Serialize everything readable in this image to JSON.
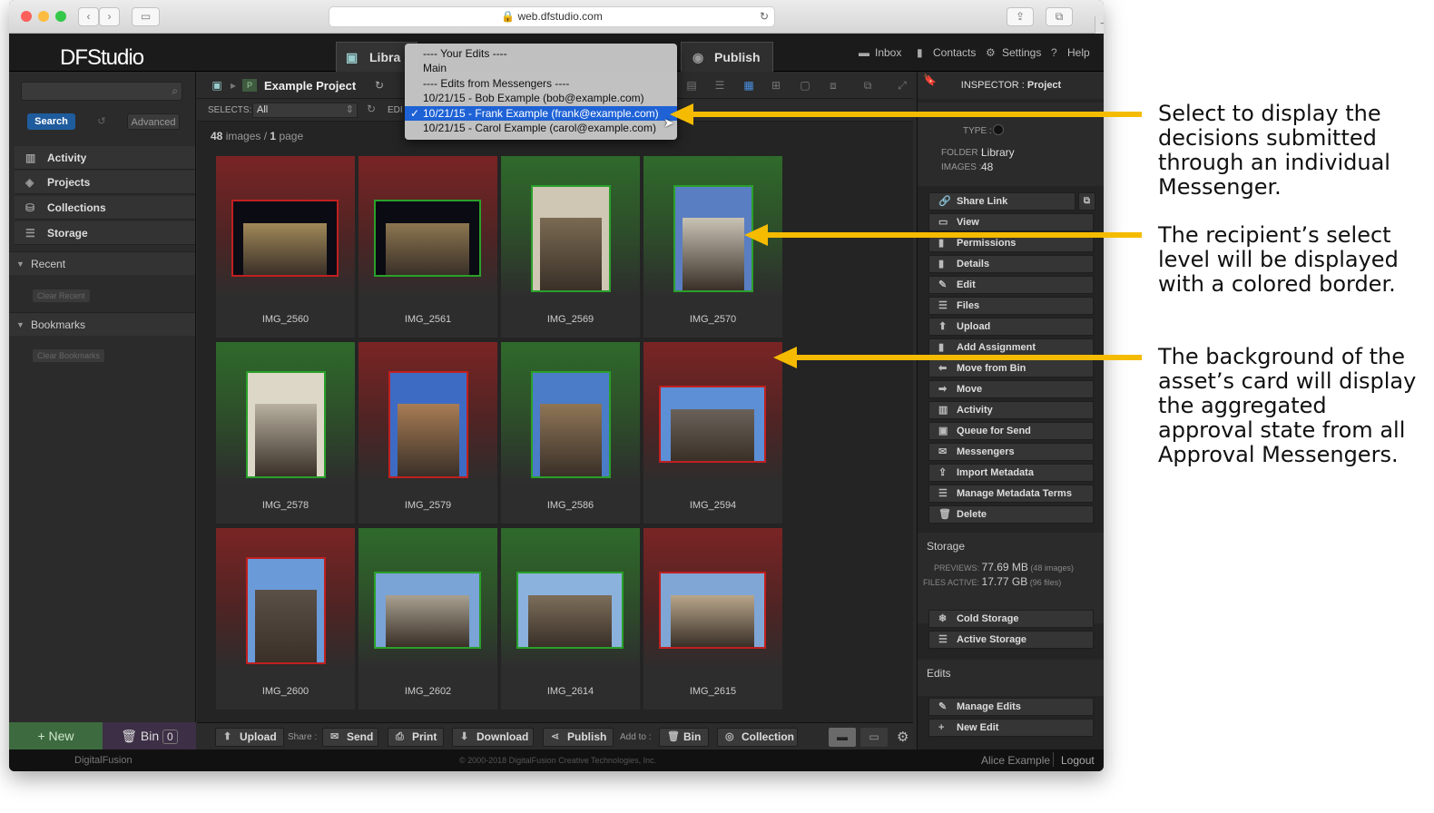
{
  "browser": {
    "url": "web.dfstudio.com",
    "new_tab": "+"
  },
  "app": {
    "logo": "DFStudio",
    "tabs": {
      "library": "Libra",
      "publish": "Publish"
    },
    "top_links": {
      "inbox": "Inbox",
      "contacts": "Contacts",
      "settings": "Settings",
      "help": "Help"
    }
  },
  "sidebar": {
    "search_button": "Search",
    "advanced_button": "Advanced",
    "items": [
      {
        "label": "Activity",
        "icon": "bar-chart-icon"
      },
      {
        "label": "Projects",
        "icon": "layers-icon"
      },
      {
        "label": "Collections",
        "icon": "database-icon"
      },
      {
        "label": "Storage",
        "icon": "storage-icon"
      }
    ],
    "recent": {
      "label": "Recent",
      "clear": "Clear Recent"
    },
    "bookmarks": {
      "label": "Bookmarks",
      "clear": "Clear Bookmarks"
    },
    "new_button": "+ New",
    "bin_label": "Bin",
    "bin_count": "0"
  },
  "main": {
    "project_title": "Example Project",
    "selects_label": "SELECTS:",
    "selects_value": "All",
    "edit_label": "EDI",
    "image_count": "48",
    "images_word": "images /",
    "page_count": "1",
    "page_word": "page",
    "cards": [
      {
        "name": "IMG_2560",
        "bg": "red",
        "border": "#c02020"
      },
      {
        "name": "IMG_2561",
        "bg": "red",
        "border": "#2aa02a"
      },
      {
        "name": "IMG_2569",
        "bg": "green",
        "border": "#2aa02a"
      },
      {
        "name": "IMG_2570",
        "bg": "green",
        "border": "#2aa02a"
      },
      {
        "name": "IMG_2578",
        "bg": "green",
        "border": "#2aa02a"
      },
      {
        "name": "IMG_2579",
        "bg": "red",
        "border": "#c02020"
      },
      {
        "name": "IMG_2586",
        "bg": "green",
        "border": "#2aa02a"
      },
      {
        "name": "IMG_2594",
        "bg": "red",
        "border": "#c02020"
      },
      {
        "name": "IMG_2600",
        "bg": "red",
        "border": "#c02020"
      },
      {
        "name": "IMG_2602",
        "bg": "green",
        "border": "#2aa02a"
      },
      {
        "name": "IMG_2614",
        "bg": "green",
        "border": "#2aa02a"
      },
      {
        "name": "IMG_2615",
        "bg": "red",
        "border": "#c02020"
      }
    ]
  },
  "dropdown": {
    "options": [
      "---- Your Edits ----",
      "Main",
      "---- Edits from Messengers ----",
      "10/21/15 - Bob Example (bob@example.com)",
      "10/21/15 - Frank Example (frank@example.com)",
      "10/21/15 - Carol Example (carol@example.com)"
    ],
    "selected_index": 4,
    "check": "✓"
  },
  "bottom_bar": {
    "upload": "Upload",
    "share_label": "Share :",
    "send": "Send",
    "print": "Print",
    "download": "Download",
    "publish": "Publish",
    "add_to_label": "Add to :",
    "bin": "Bin",
    "collection": "Collection"
  },
  "inspector": {
    "header_prefix": "INSPECTOR :",
    "header_value": "Project",
    "type_label": "TYPE :",
    "folder_label": "FOLDER :",
    "folder_value": "Library",
    "images_label": "IMAGES :",
    "images_value": "48",
    "actions": [
      "Share Link",
      "View",
      "Permissions",
      "Details",
      "Edit",
      "Files",
      "Upload",
      "Add Assignment",
      "Move from Bin",
      "Move",
      "Activity",
      "Queue for Send",
      "Messengers",
      "Import Metadata",
      "Manage Metadata Terms",
      "Delete"
    ],
    "storage": {
      "title": "Storage",
      "previews_label": "PREVIEWS:",
      "previews_value": "77.69 MB",
      "previews_note": "(48 images)",
      "files_label": "FILES ACTIVE:",
      "files_value": "17.77 GB",
      "files_note": "(96 files)",
      "cold": "Cold Storage",
      "active": "Active Storage"
    },
    "edits": {
      "title": "Edits",
      "manage": "Manage Edits",
      "new": "New Edit"
    }
  },
  "footer": {
    "brand": "DigitalFusion",
    "copyright": "© 2000-2018 DigitalFusion Creative Technologies, Inc.",
    "user": "Alice Example",
    "logout": "Logout"
  },
  "annotations": [
    "Select to display the decisions submitted through an individual Messenger.",
    "The recipient’s select level will be displayed with a colored border.",
    "The background of the asset’s card will display the aggregated approval state from all Approval Messengers."
  ],
  "colors": {
    "arrow": "#f5bb00",
    "highlight": "#1e62d6",
    "red_card": "#7a2424",
    "green_card": "#2f6a2b"
  }
}
